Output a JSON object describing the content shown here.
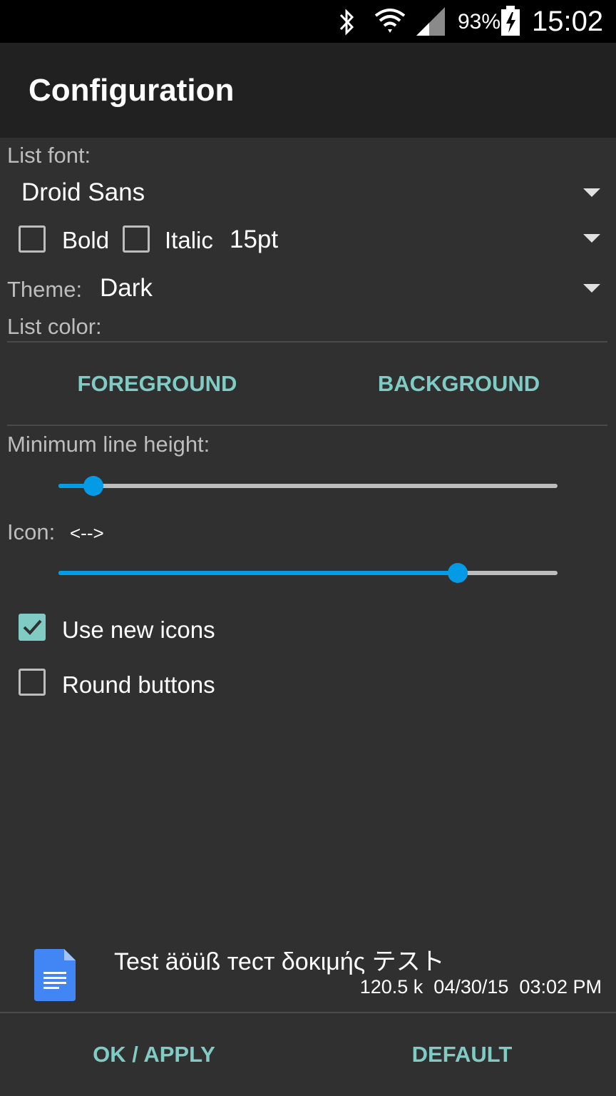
{
  "status_bar": {
    "battery_percent": "93%",
    "time": "15:02"
  },
  "action_bar": {
    "title": "Configuration"
  },
  "list_font": {
    "label": "List font:",
    "value": "Droid Sans"
  },
  "style": {
    "bold_label": "Bold",
    "bold_checked": false,
    "italic_label": "Italic",
    "italic_checked": false,
    "size_value": "15pt"
  },
  "theme": {
    "label": "Theme:",
    "value": "Dark"
  },
  "list_color": {
    "label": "List color:",
    "foreground_label": "FOREGROUND",
    "background_label": "BACKGROUND"
  },
  "line_height": {
    "label": "Minimum line height:",
    "slider_fraction": 0.07
  },
  "icon": {
    "label": "Icon:",
    "value": "<-->",
    "slider_fraction": 0.8
  },
  "options": {
    "use_new_icons_label": "Use new icons",
    "use_new_icons_checked": true,
    "round_buttons_label": "Round buttons",
    "round_buttons_checked": false
  },
  "preview": {
    "filename": "Test äöüß тест δοκιμής テスト",
    "size": "120.5 k",
    "date": "04/30/15",
    "time": "03:02 PM"
  },
  "footer": {
    "ok_label": "OK / APPLY",
    "default_label": "DEFAULT"
  },
  "colors": {
    "accent_teal": "#80cbc4",
    "slider_blue": "#039be5",
    "background": "#303030",
    "action_bar": "#212121",
    "doc_icon_blue": "#4285f4"
  }
}
